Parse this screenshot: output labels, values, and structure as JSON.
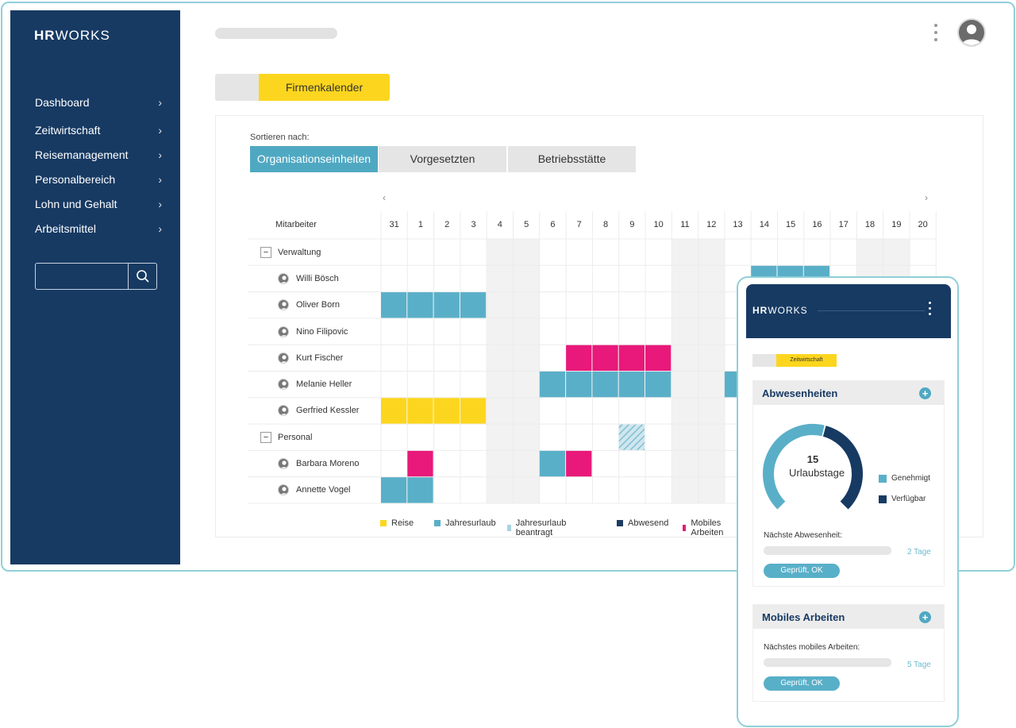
{
  "app": {
    "logo_bold": "HR",
    "logo_light": "WORKS"
  },
  "sidebar": {
    "items": [
      {
        "label": "Dashboard"
      },
      {
        "label": "Zeitwirtschaft"
      },
      {
        "label": "Reisemanagement"
      },
      {
        "label": "Personalbereich"
      },
      {
        "label": "Lohn und Gehalt"
      },
      {
        "label": "Arbeitsmittel"
      }
    ],
    "search": {
      "placeholder": ""
    }
  },
  "tabs": {
    "active_label": "Firmenkalender"
  },
  "calendar": {
    "sort_label": "Sortieren nach:",
    "sort_tabs": [
      "Organisationseinheiten",
      "Vorgesetzten",
      "Betriebsstätte"
    ],
    "employee_header": "Mitarbeiter",
    "days": [
      "31",
      "1",
      "2",
      "3",
      "4",
      "5",
      "6",
      "7",
      "8",
      "9",
      "10",
      "11",
      "12",
      "13",
      "14",
      "15",
      "16",
      "17",
      "18",
      "19",
      "20"
    ],
    "weekend_day_indices": [
      4,
      5,
      11,
      12,
      18,
      19
    ],
    "rows": [
      {
        "type": "group",
        "label": "Verwaltung"
      },
      {
        "type": "person",
        "label": "Willi Bösch"
      },
      {
        "type": "person",
        "label": "Oliver Born"
      },
      {
        "type": "person",
        "label": "Nino Filipovic"
      },
      {
        "type": "person",
        "label": "Kurt Fischer"
      },
      {
        "type": "person",
        "label": "Melanie Heller"
      },
      {
        "type": "person",
        "label": "Gerfried Kessler"
      },
      {
        "type": "group",
        "label": "Personal"
      },
      {
        "type": "person",
        "label": "Barbara Moreno"
      },
      {
        "type": "person",
        "label": "Annette Vogel"
      }
    ],
    "entries": [
      {
        "row": 1,
        "from": 14,
        "to": 16,
        "kind": "jahresurlaub"
      },
      {
        "row": 2,
        "from": 0,
        "to": 3,
        "kind": "jahresurlaub"
      },
      {
        "row": 4,
        "from": 7,
        "to": 10,
        "kind": "mobiles"
      },
      {
        "row": 5,
        "from": 6,
        "to": 10,
        "kind": "jahresurlaub"
      },
      {
        "row": 5,
        "from": 13,
        "to": 13,
        "kind": "jahresurlaub"
      },
      {
        "row": 6,
        "from": 0,
        "to": 3,
        "kind": "reise"
      },
      {
        "row": 7,
        "from": 9,
        "to": 9,
        "kind": "beantragt"
      },
      {
        "row": 8,
        "from": 1,
        "to": 1,
        "kind": "mobiles"
      },
      {
        "row": 8,
        "from": 6,
        "to": 6,
        "kind": "jahresurlaub"
      },
      {
        "row": 8,
        "from": 7,
        "to": 7,
        "kind": "mobiles"
      },
      {
        "row": 9,
        "from": 0,
        "to": 1,
        "kind": "jahresurlaub"
      }
    ],
    "legend": [
      {
        "label": "Reise",
        "color": "#fcd61e"
      },
      {
        "label": "Jahresurlaub",
        "color": "#5aafc8"
      },
      {
        "label": "Jahresurlaub beantragt",
        "color": "#a8d3df"
      },
      {
        "label": "Abwesend",
        "color": "#1c3c61"
      },
      {
        "label": "Mobiles Arbeiten",
        "color": "#e8197a"
      }
    ]
  },
  "colors": {
    "reise": "#fcd61e",
    "jahresurlaub": "#5aafc8",
    "mobiles": "#e8197a",
    "abwesend": "#1c3c61",
    "navy": "#173a63"
  },
  "mobile": {
    "logo_bold": "HR",
    "logo_light": "WORKS",
    "tab_label": "Zeitwirtschaft",
    "absences": {
      "title": "Abwesenheiten",
      "days_count": "15",
      "days_label": "Urlaubstage",
      "approved_fraction": 0.55,
      "legend": [
        {
          "label": "Genehmigt",
          "color": "#5aafc8"
        },
        {
          "label": "Verfügbar",
          "color": "#173a63"
        }
      ],
      "next_label": "Nächste Abwesenheit:",
      "next_days": "2 Tage",
      "status": "Geprüft, OK"
    },
    "mobile_work": {
      "title": "Mobiles Arbeiten",
      "next_label": "Nächstes mobiles Arbeiten:",
      "next_days": "5 Tage",
      "status": "Geprüft, OK"
    }
  }
}
